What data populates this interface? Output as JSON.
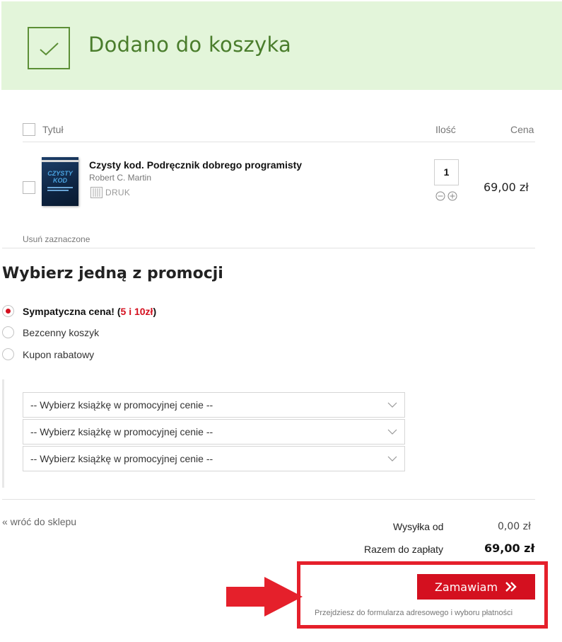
{
  "banner": {
    "title": "Dodano do koszyka"
  },
  "cart": {
    "headers": {
      "title": "Tytuł",
      "quantity": "Ilość",
      "price": "Cena"
    },
    "items": [
      {
        "title": "Czysty kod. Podręcznik dobrego programisty",
        "author": "Robert C. Martin",
        "format": "DRUK",
        "quantity": "1",
        "price": "69,00 zł",
        "cover_text": "CZYSTY KOD"
      }
    ],
    "remove_selected": "Usuń zaznaczone"
  },
  "promo": {
    "title": "Wybierz jedną z promocji",
    "options": [
      {
        "label": "Sympatyczna cena!",
        "extra_open": "(",
        "extra": "5 i 10zł",
        "extra_close": ")",
        "selected": true
      },
      {
        "label": "Bezcenny koszyk",
        "selected": false
      },
      {
        "label": "Kupon rabatowy",
        "selected": false
      }
    ],
    "selects": [
      {
        "value": "-- Wybierz książkę w promocyjnej cenie --"
      },
      {
        "value": "-- Wybierz książkę w promocyjnej cenie --"
      },
      {
        "value": "-- Wybierz książkę w promocyjnej cenie --"
      }
    ]
  },
  "footer": {
    "back_link": "«  wróć do sklepu",
    "shipping_label": "Wysyłka od",
    "shipping_value": "0,00 zł",
    "total_label": "Razem do zapłaty",
    "total_value": "69,00 zł",
    "order_button": "Zamawiam",
    "order_note": "Przejdziesz do formularza adresowego i wyboru płatności"
  },
  "colors": {
    "accent": "#d4101f",
    "banner_bg": "#e3f5da",
    "banner_text": "#4a7d2c",
    "highlight": "#e5202b"
  },
  "icons": [
    "check-icon",
    "print-book-icon",
    "minus-circle-icon",
    "plus-circle-icon",
    "chevron-down-icon",
    "double-chevron-right-icon",
    "red-arrow-icon"
  ]
}
